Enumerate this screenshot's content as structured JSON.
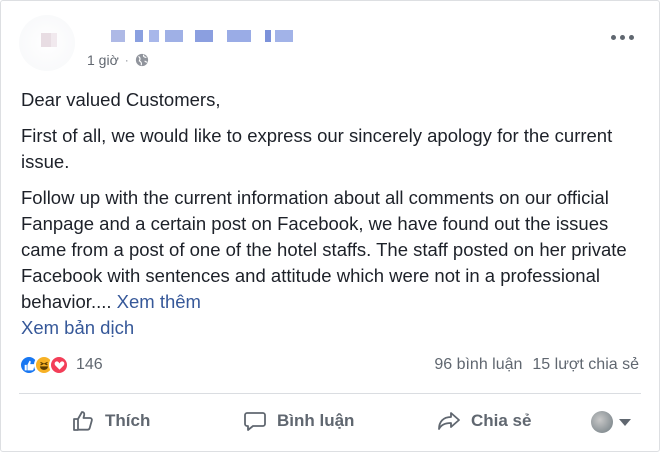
{
  "post": {
    "time": "1 giờ",
    "separator": "·",
    "paragraphs": [
      "Dear valued Customers,",
      "First of all, we would like to express our sincerely apology for the current issue.",
      "Follow up with the current information about all comments on our official Fanpage and a certain post on Facebook, we have found out the issues came from a post of one of the hotel staffs. The staff posted on her private Facebook with sentences and attitude which were not in a professional behavior...."
    ],
    "see_more": "Xem thêm",
    "translate": "Xem bản dịch"
  },
  "stats": {
    "reaction_count": "146",
    "comments": "96 bình luận",
    "shares": "15 lượt chia sẻ"
  },
  "actions": {
    "like": "Thích",
    "comment": "Bình luận",
    "share": "Chia sẻ"
  },
  "colors": {
    "link": "#365899",
    "muted": "#606770",
    "like": "#1877f2",
    "haha": "#f7b125",
    "love": "#f33e58"
  }
}
